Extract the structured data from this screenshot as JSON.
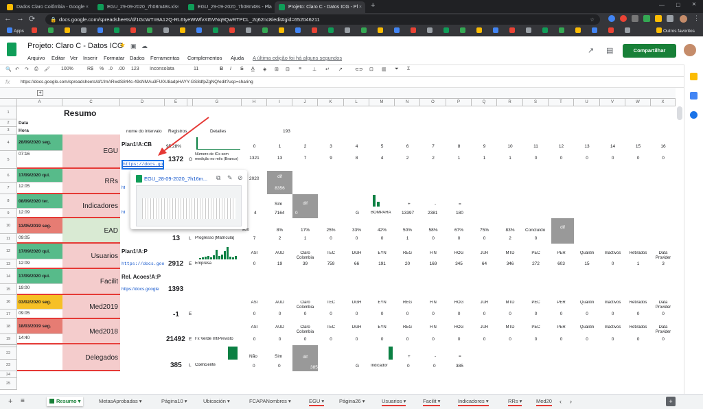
{
  "browser": {
    "tabs": [
      {
        "title": "Dados Claro Colômbia - Google",
        "color": "#fbbc04"
      },
      {
        "title": "EGU_29-09-2020_7h08m48s.xls",
        "color": "#0f9d58"
      },
      {
        "title": "EGU_29-09-2020_7h08m48s - Pla",
        "color": "#0f9d58"
      },
      {
        "title": "Projeto: Claro C - Datos ICG - Pl",
        "color": "#0f9d58"
      }
    ],
    "url": "docs.google.com/spreadsheets/d/1GcWTn9A12Q-RL6tyeWWfvXt5VNq9QwRTPCL_2q62nc8/edit#gid=652046211",
    "bookmarks_apps": "Apps",
    "bookmarks_other": "Outros favoritos"
  },
  "sheet": {
    "title": "Projeto: Claro C - Datos ICG",
    "menu": [
      "Arquivo",
      "Editar",
      "Ver",
      "Inserir",
      "Formatar",
      "Dados",
      "Ferramentas",
      "Complementos",
      "Ajuda"
    ],
    "last_edit": "A última edição foi há alguns segundos",
    "share_label": "Compartilhar",
    "toolbar": {
      "zoom": "100%",
      "currency": "R$",
      "percent": "%",
      "dec0": ".0",
      "dec00": ".00",
      "fmt": "123",
      "font": "Inconsolata",
      "size": "11"
    },
    "fx_label": "fx",
    "formula": "https://docs.google.com/spreadsheets/d/1fmARwdS844c-49sNMAu3FU0U8adpHAYY-GS8dfpZgNQ/edit?usp=sharing"
  },
  "columns": [
    "A",
    "C",
    "D",
    "E",
    "G",
    "H",
    "I",
    "J",
    "K",
    "L",
    "M",
    "N",
    "O",
    "P",
    "Q",
    "R",
    "S",
    "T",
    "U",
    "V",
    "W",
    "X"
  ],
  "rows": [
    "1",
    "2",
    "3",
    "4",
    "5",
    "6",
    "7",
    "8",
    "9",
    "10",
    "11",
    "12",
    "13",
    "14",
    "15",
    "16",
    "17",
    "18",
    "19",
    "20",
    "21",
    "22",
    "23",
    "24",
    "25"
  ],
  "header": {
    "resumo": "Resumo",
    "data": "Data",
    "hora": "Hora",
    "nome_intervalo": "nome do intervalo",
    "registros": "Registros",
    "detalles": "Detalles",
    "v193": "193"
  },
  "blocks": [
    {
      "date": "28/09/2020 seg.",
      "time": "07:16",
      "name": "EGU",
      "range": "Plan1!A:CB",
      "link": "https://docs.goo",
      "pct": "95,28%",
      "count": "1372",
      "flag": "O",
      "datecolor": "#57bb8a"
    },
    {
      "date": "17/09/2020 qui.",
      "time": "12:05",
      "name": "RRs",
      "link": "ht",
      "datecolor": "#57bb8a"
    },
    {
      "date": "08/09/2020 ter.",
      "time": "12:09",
      "name": "Indicadores",
      "link": "ht",
      "datecolor": "#57bb8a"
    },
    {
      "date": "13/05/2019 seg.",
      "time": "09:05",
      "name": "EAD",
      "count": "13",
      "flag": "L",
      "datecolor": "#e67c73"
    },
    {
      "date": "17/09/2020 qui.",
      "time": "12:09",
      "name": "Usuarios",
      "range": "Plan1!A:P",
      "link": "https://docs.goo",
      "count": "2912",
      "flag": "E",
      "datecolor": "#57bb8a"
    },
    {
      "date": "17/09/2020 qui.",
      "time": "19:00",
      "name": "Facilit",
      "range": "Rel. Acoes!A:P",
      "link": "https://docs.google",
      "count": "1393",
      "datecolor": "#57bb8a"
    },
    {
      "date": "03/02/2020 seg.",
      "time": "09:05",
      "name": "Med2019",
      "count": "-1",
      "flag": "E",
      "datecolor": "#f6c026"
    },
    {
      "date": "18/03/2019 seg.",
      "time": "14:40",
      "name": "Med2018",
      "count": "21492",
      "flag": "E",
      "datecolor": "#e67c73"
    },
    {
      "name": "Delegados",
      "count": "385",
      "flag": "L"
    }
  ],
  "row4_nums": [
    "0",
    "1",
    "2",
    "3",
    "4",
    "5",
    "6",
    "7",
    "8",
    "9",
    "10",
    "11",
    "12",
    "13",
    "14",
    "15",
    "16"
  ],
  "row5": {
    "label": "Número de ICs sem medição no mês (Branco)",
    "vals": [
      "1321",
      "13",
      "7",
      "9",
      "8",
      "4",
      "2",
      "2",
      "1",
      "1",
      "1",
      "0",
      "0",
      "0",
      "0",
      "0",
      "0"
    ]
  },
  "row7": {
    "v2020": "2020",
    "dif": "dif",
    "v8356": "8356"
  },
  "row8": {
    "sim": "Sim",
    "dif": "dif",
    "plus": "+",
    "minus": "-",
    "eq": "="
  },
  "row9": {
    "v4": "4",
    "v7164": "7164",
    "v0": "0",
    "g": "G",
    "bompara": "BOMPARA",
    "v13397": "13397",
    "v2381": "2381",
    "v180": "180"
  },
  "row10": {
    "label": "ado",
    "pcts": [
      "8%",
      "17%",
      "25%",
      "33%",
      "42%",
      "50%",
      "58%",
      "67%",
      "75%",
      "83%"
    ],
    "concluido": "Concluído",
    "dif": "dif"
  },
  "row11": {
    "label": "Progresso [Matrícula]",
    "vals": [
      "7",
      "2",
      "1",
      "0",
      "0",
      "0",
      "1",
      "0",
      "0",
      "0",
      "2",
      "0"
    ]
  },
  "cats": [
    "ASI",
    "AUD",
    "Claro Colombia",
    "TEC",
    "DGH",
    "EYN",
    "REG",
    "FIN",
    "HOG",
    "JUR",
    "MTD",
    "PEC",
    "PER",
    "Qualitin",
    "Inactivos",
    "Retirados",
    "Data Provider"
  ],
  "row13": {
    "label": "Empresa",
    "vals": [
      "0",
      "19",
      "39",
      "759",
      "66",
      "191",
      "20",
      "169",
      "345",
      "64",
      "346",
      "272",
      "603",
      "15",
      "0",
      "1",
      "3"
    ]
  },
  "row17vals": [
    "0",
    "0",
    "0",
    "0",
    "0",
    "0",
    "0",
    "0",
    "0",
    "0",
    "0",
    "0",
    "0",
    "0",
    "0",
    "0",
    "0"
  ],
  "row19": {
    "label": "Fx Verde Inf/Previsto",
    "vals": [
      "0",
      "0",
      "0",
      "0",
      "0",
      "0",
      "0",
      "0",
      "0",
      "0",
      "0",
      "0",
      "0",
      "0",
      "0",
      "0",
      "0"
    ]
  },
  "row22": {
    "nao": "Não",
    "sim": "Sim",
    "dif": "dif",
    "plus": "+",
    "minus": "-",
    "eq": "="
  },
  "row23": {
    "label": "Coeficiente",
    "v0a": "0",
    "v0b": "0",
    "v385": "385",
    "g": "G",
    "ind": "Indicador",
    "v0c": "0",
    "v0d": "0",
    "v385b": "385"
  },
  "popup": {
    "title": "EGU_28-09-2020_7h16m..."
  },
  "sheet_tabs": [
    "Resumo",
    "MetasAprobadas",
    "Página10",
    "Ubicación",
    "FCAPANombres",
    "EGU",
    "Página26",
    "Usuarios",
    "Facilit",
    "Indicadores",
    "RRs",
    "Med20"
  ]
}
